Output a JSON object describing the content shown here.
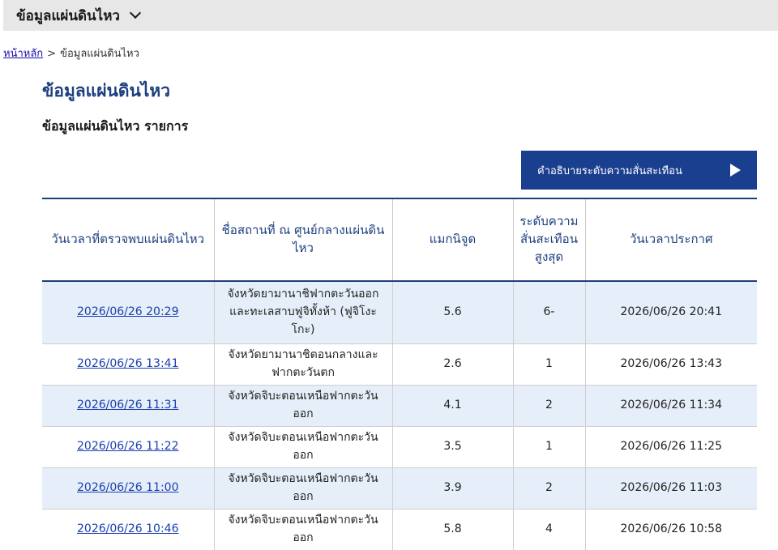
{
  "header": {
    "title": "ข้อมูลแผ่นดินไหว"
  },
  "breadcrumb": {
    "home": "หน้าหลัก",
    "separator": ">",
    "current": "ข้อมูลแผ่นดินไหว"
  },
  "page": {
    "title": "ข้อมูลแผ่นดินไหว",
    "subtitle": "ข้อมูลแผ่นดินไหว รายการ",
    "intensity_button": "คำอธิบายระดับความสั่นสะเทือน"
  },
  "table": {
    "headers": {
      "detected": "วันเวลาที่ตรวจพบแผ่นดินไหว",
      "epicenter": "ชื่อสถานที่ ณ ศูนย์กลางแผ่นดินไหว",
      "magnitude": "แมกนิจูด",
      "intensity": "ระดับความสั่นสะเทือนสูงสุด",
      "announced": "วันเวลาประกาศ"
    },
    "rows": [
      {
        "detected": "2026/06/26 20:29",
        "epicenter": "จังหวัดยามานาชิฟากตะวันออก และทะเลสาบฟูจิทั้งห้า (ฟูจิโงะโกะ)",
        "magnitude": "5.6",
        "intensity": "6-",
        "announced": "2026/06/26 20:41"
      },
      {
        "detected": "2026/06/26 13:41",
        "epicenter": "จังหวัดยามานาชิตอนกลางและฟากตะวันตก",
        "magnitude": "2.6",
        "intensity": "1",
        "announced": "2026/06/26 13:43"
      },
      {
        "detected": "2026/06/26 11:31",
        "epicenter": "จังหวัดจิบะตอนเหนือฟากตะวันออก",
        "magnitude": "4.1",
        "intensity": "2",
        "announced": "2026/06/26 11:34"
      },
      {
        "detected": "2026/06/26 11:22",
        "epicenter": "จังหวัดจิบะตอนเหนือฟากตะวันออก",
        "magnitude": "3.5",
        "intensity": "1",
        "announced": "2026/06/26 11:25"
      },
      {
        "detected": "2026/06/26 11:00",
        "epicenter": "จังหวัดจิบะตอนเหนือฟากตะวันออก",
        "magnitude": "3.9",
        "intensity": "2",
        "announced": "2026/06/26 11:03"
      },
      {
        "detected": "2026/06/26 10:46",
        "epicenter": "จังหวัดจิบะตอนเหนือฟากตะวันออก",
        "magnitude": "5.8",
        "intensity": "4",
        "announced": "2026/06/26 10:58"
      }
    ]
  },
  "colors": {
    "accent": "#1c3f7f",
    "button": "#1b3f8f",
    "row_highlight": "#e6eff9",
    "top_bar": "#e7e7e7",
    "link": "#1a3fb0"
  },
  "icons": {
    "header_toggle": "chevron-down-icon",
    "button_arrow": "play-arrow-icon"
  }
}
